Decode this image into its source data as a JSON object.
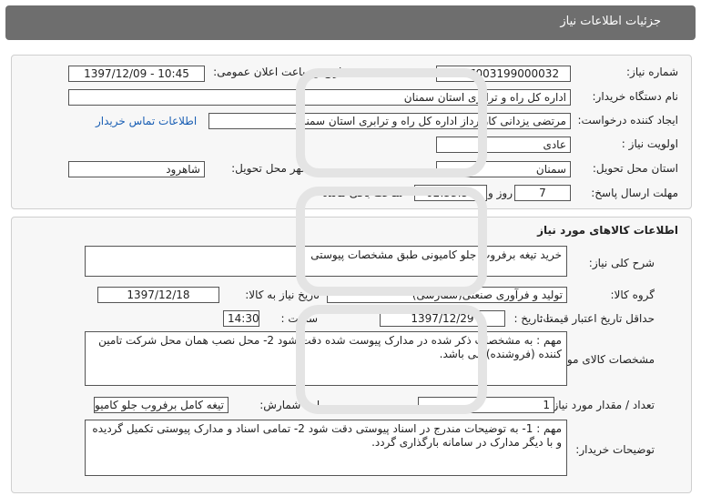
{
  "header": {
    "title": "جزئیات اطلاعات نیاز"
  },
  "need_info": {
    "need_number_label": "شماره نیاز:",
    "need_number": "1297003199000032",
    "announce_label": "تاریخ و ساعت اعلان عمومی:",
    "announce_value": "1397/12/09 - 10:45",
    "buyer_org_label": "نام دستگاه خریدار:",
    "buyer_org": "اداره کل راه و ترابری استان سمنان",
    "requester_label": "ایجاد کننده درخواست:",
    "requester": "مرتضی یزدانی کارپرداز اداره کل راه و ترابری استان سمنان",
    "contact_link": "اطلاعات تماس خریدار",
    "priority_label": "اولویت نیاز :",
    "priority": "عادی",
    "province_label": "استان محل تحویل:",
    "province": "سمنان",
    "city_label": "شهر محل تحویل:",
    "city": "شاهرود",
    "deadline_label": "مهلت ارسال پاسخ:",
    "days": "7",
    "days_unit": "روز و",
    "time_left": "02:33:54",
    "time_left_label": "ساعت باقی مانده"
  },
  "goods_info": {
    "section_title": "اطلاعات کالاهای مورد نیاز",
    "general_desc_label": "شرح کلی نیاز:",
    "general_desc": "خرید تیغه برفروب جلو کامیونی طبق مشخصات پیوستی",
    "goods_group_label": "گروه کالا:",
    "goods_group": "تولید و فرآوری صنعتی(سفارشی)",
    "need_date_label": "تاریخ نیاز به کالا:",
    "need_date": "1397/12/18",
    "price_validity_label": "حداقل تاریخ اعتبار قیمت:",
    "to_date_label": "تا تاریخ :",
    "validity_date": "1397/12/29",
    "hour_label": "ساعت :",
    "validity_time": "14:30",
    "specs_label": "مشخصات کالای مورد نیاز:",
    "specs": "مهم : به مشخصات ذکر شده در مدارک پیوست شده دقت شود   2- محل نصب همان محل شرکت تامین کننده (فروشنده) می باشد.",
    "qty_label": "تعداد / مقدار مورد نیاز:",
    "qty": "1",
    "unit_label": "واحد شمارش:",
    "unit": "تیغه کامل برفروب جلو کامیون",
    "buyer_notes_label": "توضیحات خریدار:",
    "buyer_notes": "مهم : 1- به توضیحات مندرج در اسناد پیوستی دقت شود     2- تمامی اسناد و مدارک پیوستی تکمیل گردیده و با دیگر مدارک در سامانه بارگذاری گردد."
  },
  "colors": {
    "header_bg": "#6e6e6e",
    "panel_bg": "#f7f7f7",
    "link": "#1a5fb4"
  }
}
